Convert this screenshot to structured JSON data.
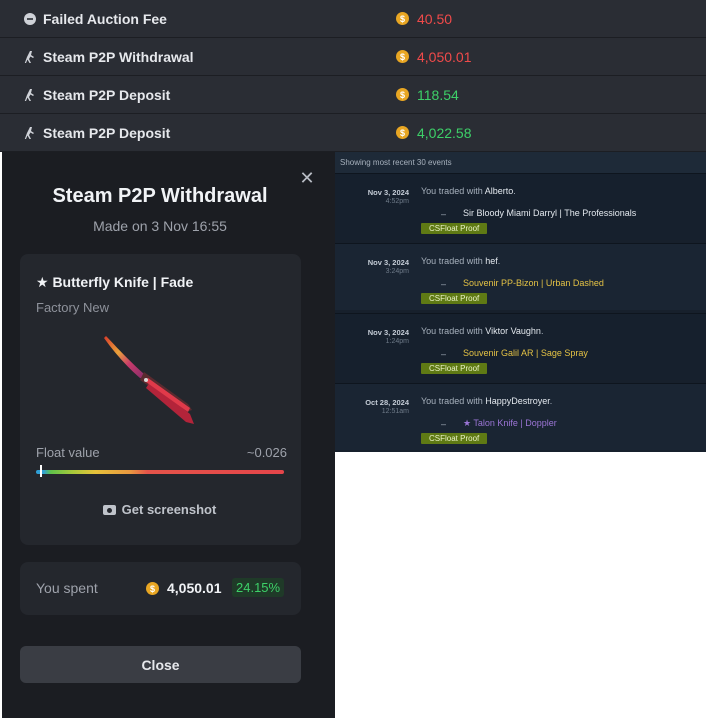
{
  "transactions": [
    {
      "icon": "minus-circle-icon",
      "name": "Failed Auction Fee",
      "amount": "40.50",
      "tone": "neg"
    },
    {
      "icon": "steam-p2p-icon",
      "name": "Steam P2P Withdrawal",
      "amount": "4,050.01",
      "tone": "neg"
    },
    {
      "icon": "steam-p2p-icon",
      "name": "Steam P2P Deposit",
      "amount": "118.54",
      "tone": "pos"
    },
    {
      "icon": "steam-p2p-icon",
      "name": "Steam P2P Deposit",
      "amount": "4,022.58",
      "tone": "pos"
    }
  ],
  "modal": {
    "title": "Steam P2P Withdrawal",
    "subtitle": "Made on 3 Nov 16:55",
    "item_name": "★ Butterfly Knife | Fade",
    "item_wear": "Factory New",
    "float_label": "Float value",
    "float_value": "~0.026",
    "float_fraction": 0.026,
    "screenshot_label": "Get screenshot",
    "spent_label": "You spent",
    "spent_amount": "4,050.01",
    "spent_pct": "24.15%",
    "close_label": "Close"
  },
  "history": {
    "header": "Showing most recent 30 events",
    "trades": [
      {
        "date": "Nov 3, 2024",
        "time": "4:52pm",
        "prefix": "You traded with",
        "partner": "Alberto",
        "item_parts": [
          "Sir Bloody Miami Darryl | The Professionals"
        ],
        "item_color": "white",
        "proof": "CSFloat Proof"
      },
      {
        "date": "Nov 3, 2024",
        "time": "3:24pm",
        "prefix": "You traded with",
        "partner": "hef",
        "item_parts": [
          "Souvenir PP-Bizon | Urban Dashed"
        ],
        "item_color": "gold",
        "proof": "CSFloat Proof"
      },
      {
        "date": "Nov 3, 2024",
        "time": "1:24pm",
        "prefix": "You traded with",
        "partner": "Viktor Vaughn",
        "item_parts": [
          "Souvenir Galil AR | Sage Spray"
        ],
        "item_color": "gold",
        "proof": "CSFloat Proof"
      },
      {
        "date": "Oct 28, 2024",
        "time": "12:51am",
        "prefix": "You traded with",
        "partner": "HappyDestroyer",
        "item_parts": [
          "★ Talon Knife | Doppler"
        ],
        "item_color": "purple",
        "proof": "CSFloat Proof"
      }
    ]
  },
  "colors": {
    "negative": "#f04a4a",
    "positive": "#3dd068",
    "coin": "#e8a623",
    "proof_button": "#5f7a14"
  }
}
